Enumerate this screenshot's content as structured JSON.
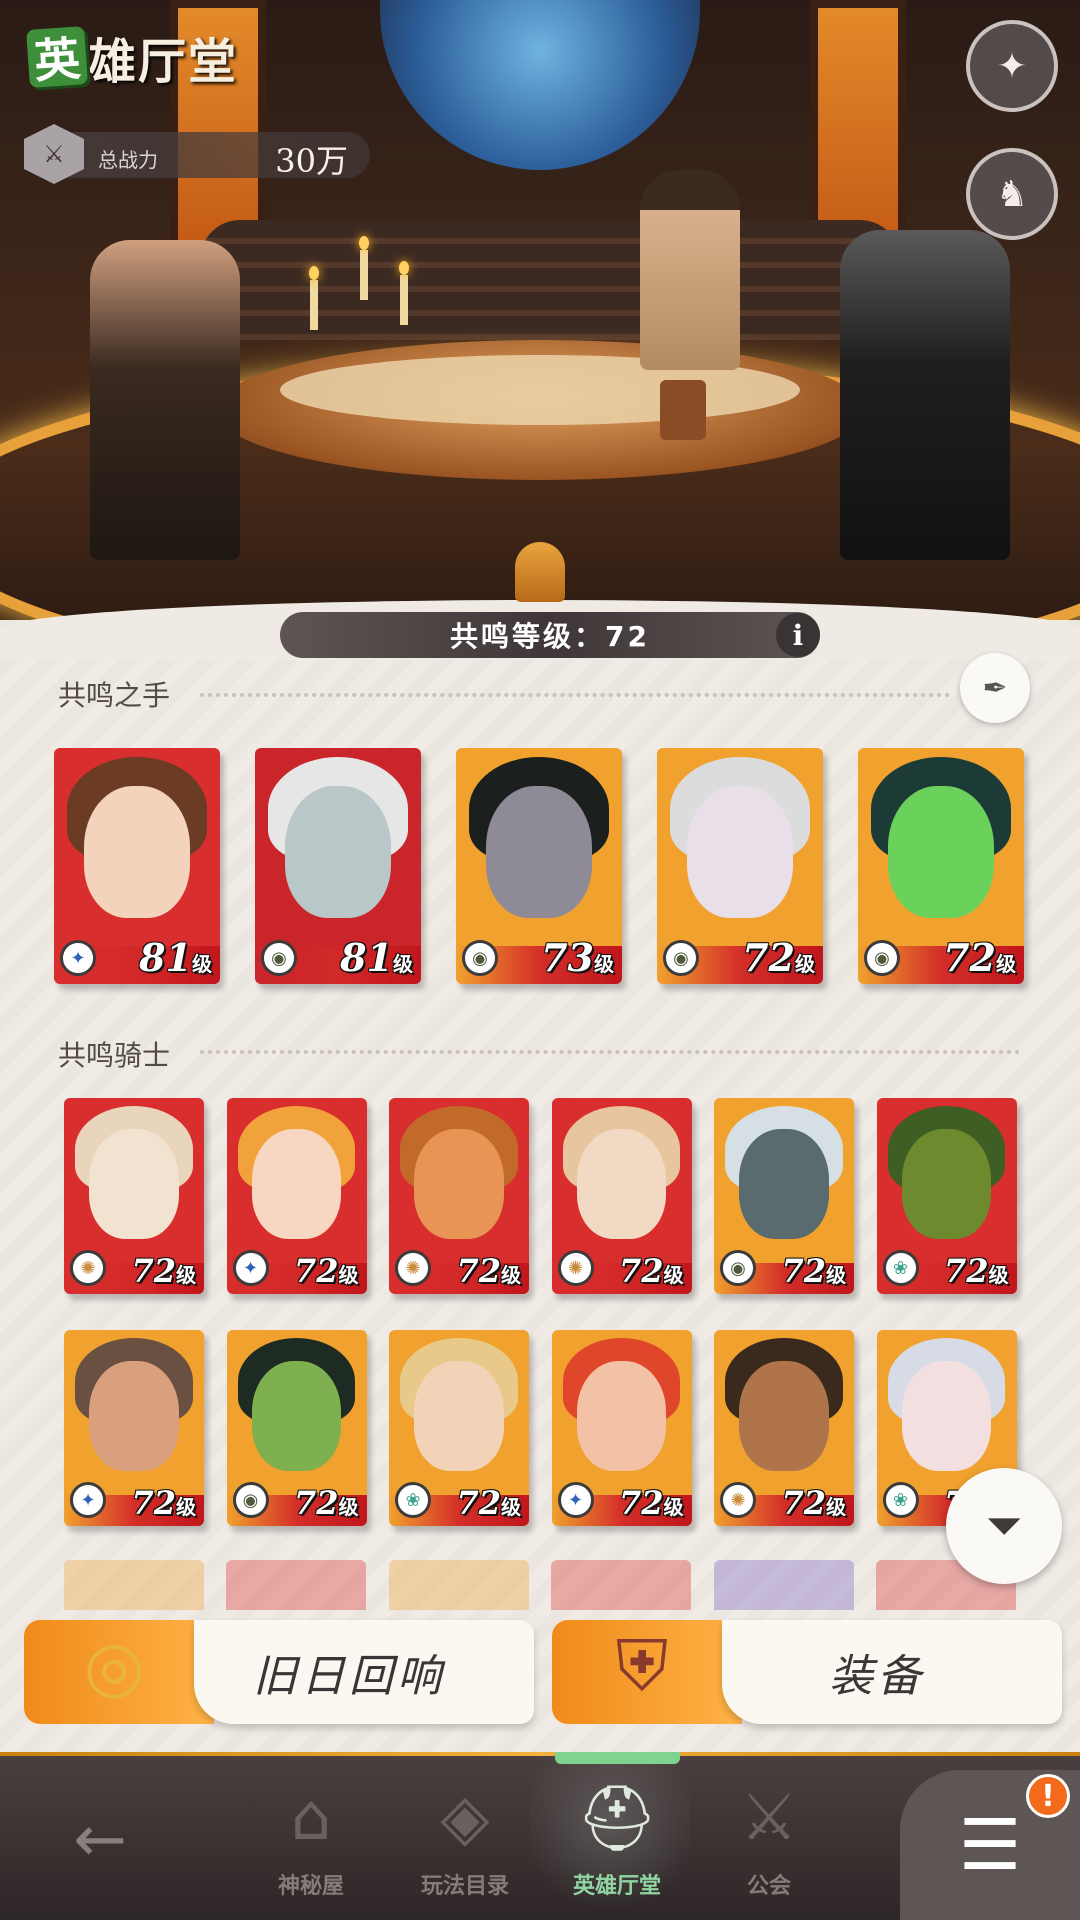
{
  "header": {
    "title_first_char": "英",
    "title_rest": "雄厅堂",
    "power_label": "总战力",
    "power_value": "30万"
  },
  "top_buttons": [
    {
      "name": "codex-book",
      "icon": "book-icon",
      "glyph": "✦"
    },
    {
      "name": "hero-helmets",
      "icon": "helmets-icon",
      "glyph": "♞"
    }
  ],
  "resonance": {
    "level_text": "共鸣等级：72",
    "info_glyph": "i"
  },
  "hands_section": {
    "title": "共鸣之手",
    "quill_glyph": "✒",
    "heroes": [
      {
        "level": "81",
        "unit": "级",
        "class_glyph": "✦",
        "class_color": "#2f63b8",
        "bg": "#d92e2e",
        "hair": "#6b3b24",
        "face": "#f4d3bd"
      },
      {
        "level": "81",
        "unit": "级",
        "class_glyph": "◉",
        "class_color": "#4f5a3a",
        "bg": "#c9252a",
        "hair": "#e6e6e6",
        "face": "#b9c7c8"
      },
      {
        "level": "73",
        "unit": "级",
        "class_glyph": "◉",
        "class_color": "#4f5a3a",
        "bg": "#f0a12e",
        "hair": "#1b1f1d",
        "face": "#8e8a96"
      },
      {
        "level": "72",
        "unit": "级",
        "class_glyph": "◉",
        "class_color": "#4f5a3a",
        "bg": "#f0a12e",
        "hair": "#dcdcdc",
        "face": "#e8dfe8"
      },
      {
        "level": "72",
        "unit": "级",
        "class_glyph": "◉",
        "class_color": "#4f5a3a",
        "bg": "#f0a12e",
        "hair": "#1c3a36",
        "face": "#6ad25b"
      }
    ]
  },
  "knights_section": {
    "title": "共鸣骑士",
    "heroes": [
      {
        "level": "72",
        "unit": "级",
        "class_glyph": "✺",
        "class_color": "#c98b3a",
        "bg": "#d92e2e",
        "hair": "#e8d5bb",
        "face": "#f2e3d0"
      },
      {
        "level": "72",
        "unit": "级",
        "class_glyph": "✦",
        "class_color": "#2f63b8",
        "bg": "#d92e2e",
        "hair": "#f2a23a",
        "face": "#f7d7c2"
      },
      {
        "level": "72",
        "unit": "级",
        "class_glyph": "✺",
        "class_color": "#c98b3a",
        "bg": "#d92e2e",
        "hair": "#c26a2a",
        "face": "#e89455"
      },
      {
        "level": "72",
        "unit": "级",
        "class_glyph": "✺",
        "class_color": "#c98b3a",
        "bg": "#d92e2e",
        "hair": "#e7c59e",
        "face": "#f2d9c4"
      },
      {
        "level": "72",
        "unit": "级",
        "class_glyph": "◉",
        "class_color": "#4f5a3a",
        "bg": "#f0a12e",
        "hair": "#d6e0e4",
        "face": "#5a6b6f"
      },
      {
        "level": "72",
        "unit": "级",
        "class_glyph": "❀",
        "class_color": "#3da58f",
        "bg": "#d92e2e",
        "hair": "#3f5e24",
        "face": "#6e8a2e"
      },
      {
        "level": "72",
        "unit": "级",
        "class_glyph": "✦",
        "class_color": "#2f63b8",
        "bg": "#f0a12e",
        "hair": "#6a5040",
        "face": "#d9a07d"
      },
      {
        "level": "72",
        "unit": "级",
        "class_glyph": "◉",
        "class_color": "#4f5a3a",
        "bg": "#f0a12e",
        "hair": "#1e2b22",
        "face": "#7fb04f"
      },
      {
        "level": "72",
        "unit": "级",
        "class_glyph": "❀",
        "class_color": "#3da58f",
        "bg": "#f0a12e",
        "hair": "#e8c98a",
        "face": "#f2d3b8"
      },
      {
        "level": "72",
        "unit": "级",
        "class_glyph": "✦",
        "class_color": "#2f63b8",
        "bg": "#f0a12e",
        "hair": "#e0472a",
        "face": "#f3c1a5"
      },
      {
        "level": "72",
        "unit": "级",
        "class_glyph": "✺",
        "class_color": "#c98b3a",
        "bg": "#f0a12e",
        "hair": "#3a2a1e",
        "face": "#b0744a"
      },
      {
        "level": "72",
        "unit": "级",
        "class_glyph": "❀",
        "class_color": "#3da58f",
        "bg": "#f0a12e",
        "hair": "#d6dbe6",
        "face": "#f3dfe0"
      }
    ]
  },
  "actions": {
    "echoes_label": "旧日回响",
    "equipment_label": "装备"
  },
  "nav": {
    "back_glyph": "←",
    "items": [
      {
        "label": "神秘屋",
        "glyph": "⌂"
      },
      {
        "label": "玩法目录",
        "glyph": "◈"
      },
      {
        "label": "英雄厅堂",
        "glyph": "⛑"
      },
      {
        "label": "公会",
        "glyph": "⚔"
      }
    ],
    "menu_glyph": "☰",
    "menu_badge": "!"
  },
  "filter_glyph": "⏷",
  "colors": {
    "accent": "#f0a12e",
    "active_nav": "#8fd6a3",
    "panel": "#efeae4"
  }
}
